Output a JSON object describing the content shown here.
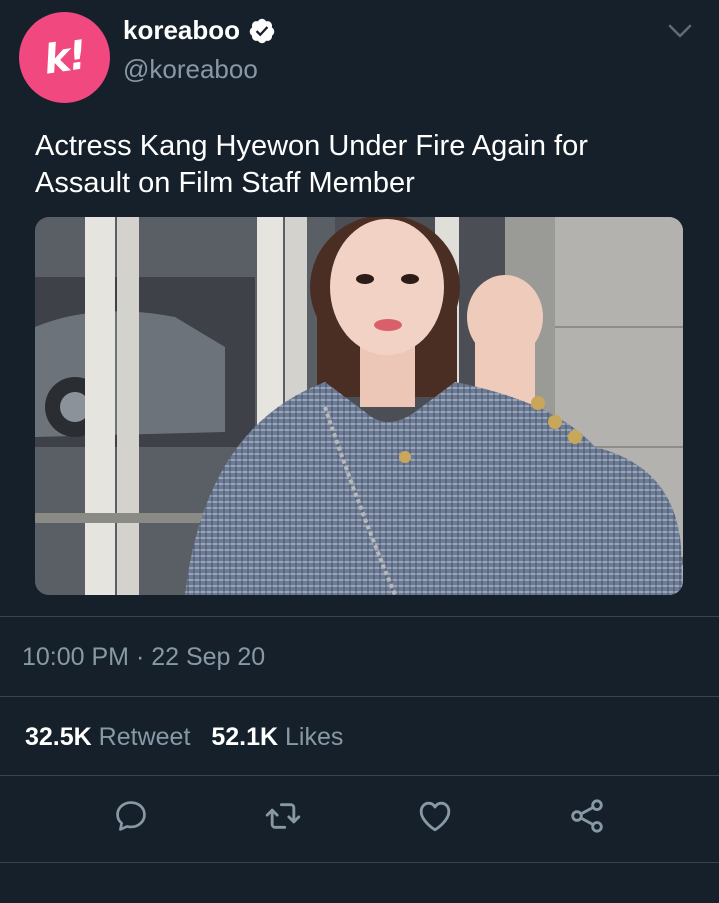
{
  "account": {
    "display_name": "koreaboo",
    "handle": "@koreaboo",
    "avatar_letter": "k!",
    "avatar_color": "#f0487f",
    "verified": true
  },
  "tweet": {
    "text_line1": "Actress Kang Hyewon Under Fire Again for",
    "text_line2": "Assault on Film Staff Member",
    "timestamp": "10:00 PM · 22 Sep 20"
  },
  "stats": {
    "retweets_count": "32.5K",
    "retweets_label": "Retweet",
    "likes_count": "52.1K",
    "likes_label": "Likes"
  },
  "actions": {
    "icons": [
      "reply-icon",
      "retweet-icon",
      "like-icon",
      "share-icon"
    ]
  },
  "colors": {
    "background": "#15202b",
    "secondary_text": "#8899a6",
    "divider": "#38444d"
  }
}
